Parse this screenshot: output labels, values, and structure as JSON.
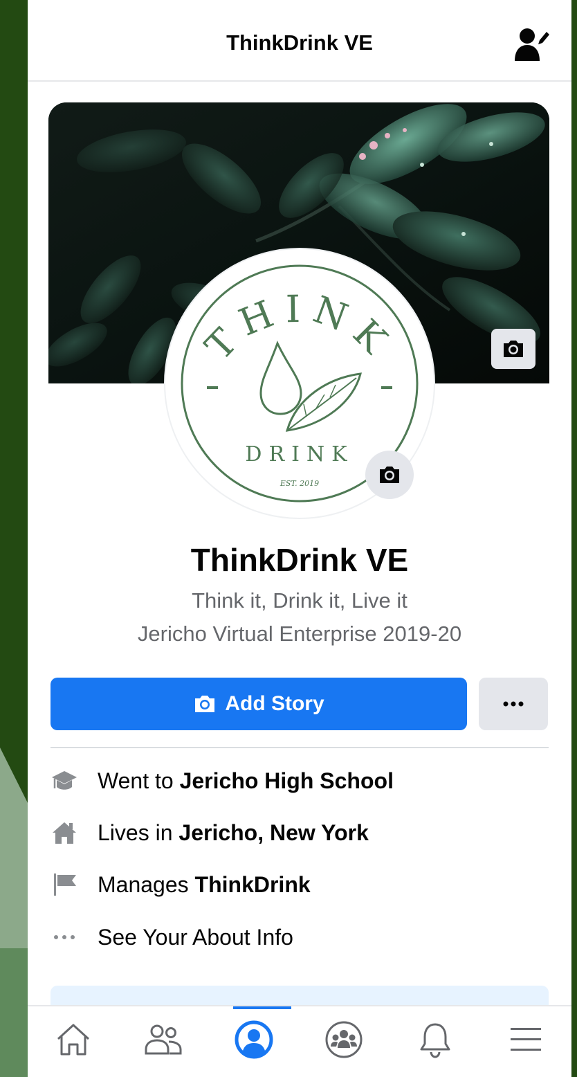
{
  "header": {
    "title": "ThinkDrink VE",
    "edit_profile_icon": "person-edit-icon"
  },
  "cover": {
    "image": "dark leaves with water droplets",
    "camera_icon": "camera-icon"
  },
  "avatar": {
    "logo_top_text": "THINK",
    "logo_bottom_text": "DRINK",
    "logo_est_text": "EST. 2019",
    "camera_icon": "camera-icon"
  },
  "profile": {
    "name": "ThinkDrink VE",
    "bio_line1": "Think it, Drink it, Live it",
    "bio_line2": "Jericho Virtual Enterprise 2019-20"
  },
  "actions": {
    "add_story_label": "Add Story",
    "more_label": "..."
  },
  "about": [
    {
      "icon": "graduation-cap-icon",
      "prefix": "Went to",
      "value": "Jericho High School"
    },
    {
      "icon": "house-icon",
      "prefix": "Lives in",
      "value": "Jericho, New York"
    },
    {
      "icon": "flag-icon",
      "prefix": "Manages",
      "value": "ThinkDrink"
    },
    {
      "icon": "more-dots-icon",
      "prefix": "See Your About Info",
      "value": ""
    }
  ],
  "tabbar": {
    "items": [
      "home-icon",
      "friends-icon",
      "profile-icon",
      "groups-icon",
      "notifications-icon",
      "menu-icon"
    ],
    "active": "profile-icon"
  },
  "colors": {
    "accent": "#1877f2",
    "background": "#234a12",
    "logo_green": "#4f7a55",
    "secondary_text": "#65676b"
  }
}
